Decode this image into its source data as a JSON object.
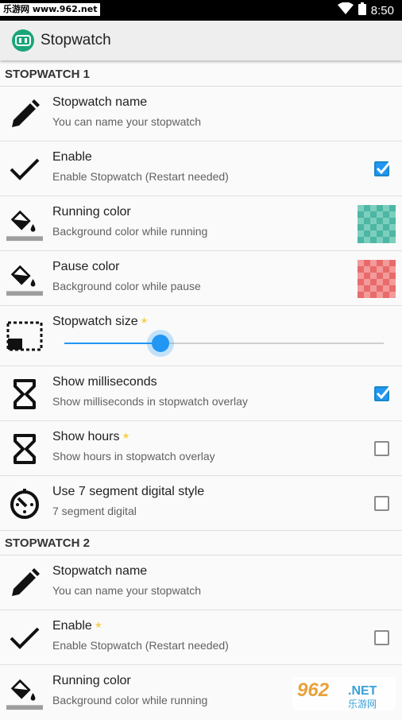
{
  "status_bar": {
    "watermark": "乐游网 www.962.net",
    "time": "8:50",
    "icons": [
      "wifi-icon",
      "battery-icon"
    ]
  },
  "app_bar": {
    "title": "Stopwatch",
    "icon": "stopwatch-app-icon"
  },
  "sections": [
    {
      "header": "STOPWATCH 1",
      "items": [
        {
          "title": "Stopwatch name",
          "summary": "You can name your stopwatch",
          "icon": "pencil-icon"
        },
        {
          "title": "Enable",
          "summary": "Enable Stopwatch (Restart needed)",
          "icon": "check-icon",
          "checked": true
        },
        {
          "title": "Running color",
          "summary": "Background color while running",
          "icon": "paint-bucket-icon",
          "swatch": "#4db6a4"
        },
        {
          "title": "Pause color",
          "summary": "Background color while pause",
          "icon": "paint-bucket-icon",
          "swatch": "#e86b6b"
        },
        {
          "title": "Stopwatch size",
          "icon": "resize-icon",
          "slider_value": 0.3,
          "starred": true
        },
        {
          "title": "Show milliseconds",
          "summary": "Show milliseconds in stopwatch overlay",
          "icon": "hourglass-icon",
          "checked": true
        },
        {
          "title": "Show hours",
          "summary": "Show hours in stopwatch overlay",
          "icon": "hourglass-icon",
          "checked": false,
          "starred": true
        },
        {
          "title": "Use 7 segment digital style",
          "summary": "7 segment digital",
          "icon": "timer-icon",
          "checked": false
        }
      ]
    },
    {
      "header": "STOPWATCH 2",
      "items": [
        {
          "title": "Stopwatch name",
          "summary": "You can name your stopwatch",
          "icon": "pencil-icon"
        },
        {
          "title": "Enable",
          "summary": "Enable Stopwatch (Restart needed)",
          "icon": "check-icon",
          "checked": false,
          "starred": true
        },
        {
          "title": "Running color",
          "summary": "Background color while running",
          "icon": "paint-bucket-icon"
        }
      ]
    }
  ],
  "watermark_logo": {
    "text_top": "962",
    "text_suffix": ".NET",
    "text_bottom": "乐游网"
  },
  "colors": {
    "accent": "#2196f3",
    "app_icon": "#1aa57a",
    "running": "#4db6a4",
    "pause": "#e86b6b",
    "star": "#f2d24e"
  }
}
